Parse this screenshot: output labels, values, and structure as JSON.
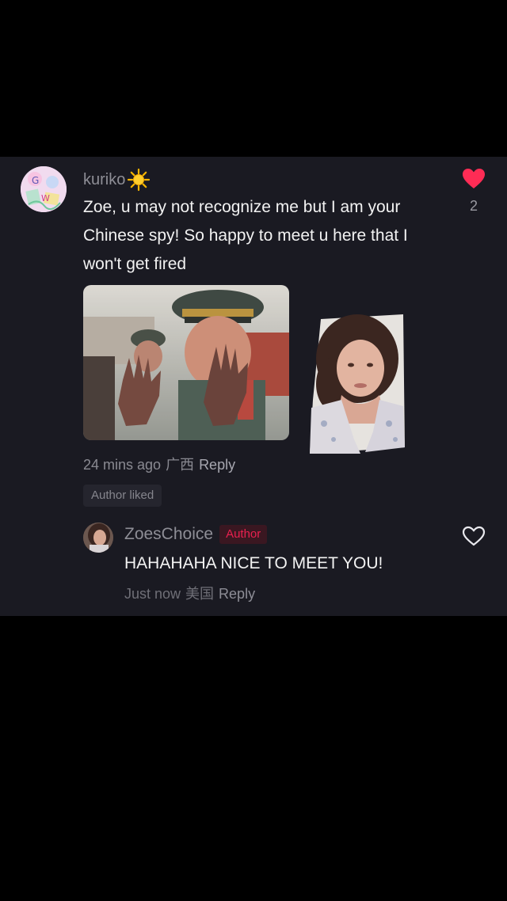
{
  "comment": {
    "username": "kuriko",
    "username_emoji": "sun-icon",
    "text": "Zoe, u may not recognize me but I am your Chinese spy! So happy to meet u here that I won't get fired",
    "time": "24 mins ago",
    "location": "广西",
    "reply_label": "Reply",
    "like_count": "2",
    "liked": true,
    "author_liked": "Author liked",
    "like_color": "#fe2c55"
  },
  "reply": {
    "username": "ZoesChoice",
    "badge": "Author",
    "text": "HAHAHAHA NICE TO MEET YOU!",
    "time": "Just now",
    "location": "美国",
    "reply_label": "Reply",
    "liked": false,
    "badge_color": "#e8204f"
  },
  "colors": {
    "background": "#000000",
    "card": "#1a1a22"
  }
}
